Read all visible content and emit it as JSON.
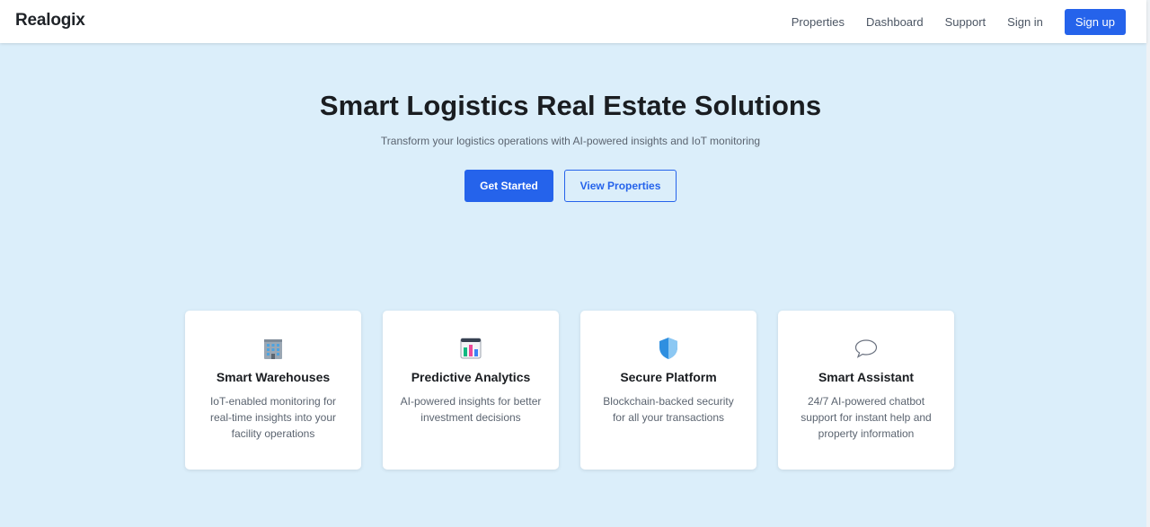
{
  "header": {
    "brand": "Realogix",
    "nav": [
      "Properties",
      "Dashboard",
      "Support",
      "Sign in"
    ],
    "signup_label": "Sign up"
  },
  "hero": {
    "title": "Smart Logistics Real Estate Solutions",
    "subtitle": "Transform your logistics operations with AI-powered insights and IoT monitoring",
    "primary_cta": "Get Started",
    "secondary_cta": "View Properties"
  },
  "features": [
    {
      "icon": "building-icon",
      "title": "Smart Warehouses",
      "description": "IoT-enabled monitoring for real-time insights into your facility operations"
    },
    {
      "icon": "bar-chart-icon",
      "title": "Predictive Analytics",
      "description": "AI-powered insights for better investment decisions"
    },
    {
      "icon": "shield-icon",
      "title": "Secure Platform",
      "description": "Blockchain-backed security for all your transactions"
    },
    {
      "icon": "speech-bubble-icon",
      "title": "Smart Assistant",
      "description": "24/7 AI-powered chatbot support for instant help and property information"
    }
  ],
  "colors": {
    "accent": "#2563eb",
    "background": "#dbeefa",
    "card": "#ffffff"
  }
}
